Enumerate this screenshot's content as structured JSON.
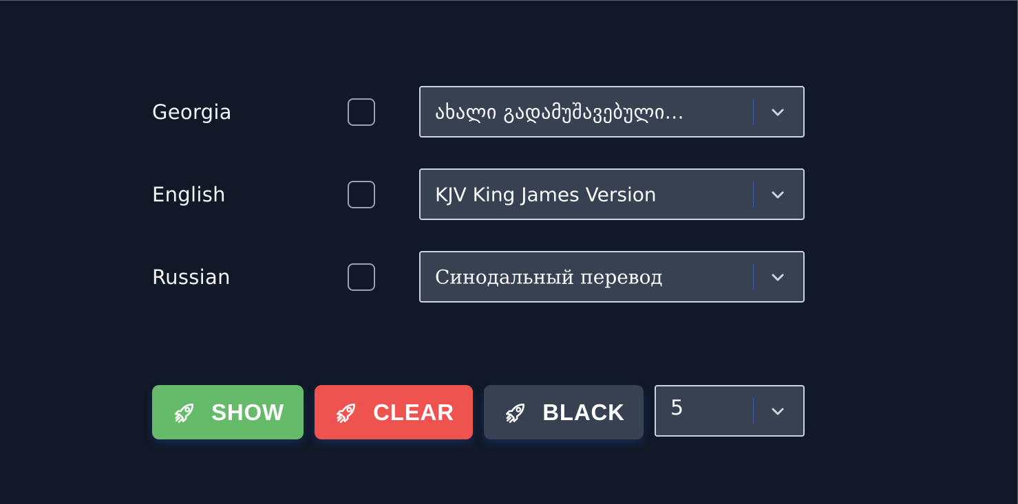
{
  "translations": [
    {
      "language": "Georgia",
      "checked": false,
      "selected_version": "ახალი გადამუშავებული..."
    },
    {
      "language": "English",
      "checked": false,
      "selected_version": "KJV King James Version"
    },
    {
      "language": "Russian",
      "checked": false,
      "selected_version": "Синодальный перевод"
    }
  ],
  "actions": {
    "show_label": "SHOW",
    "clear_label": "CLEAR",
    "black_label": "BLACK",
    "count_value": "5"
  },
  "icons": {
    "button_icon": "rocket-icon",
    "select_icon": "chevron-down-icon"
  },
  "colors": {
    "background": "#111827",
    "select_bg": "#374151",
    "show": "#66bb6a",
    "clear": "#ef5350",
    "black": "#374151",
    "divider": "#3b5bb5"
  }
}
